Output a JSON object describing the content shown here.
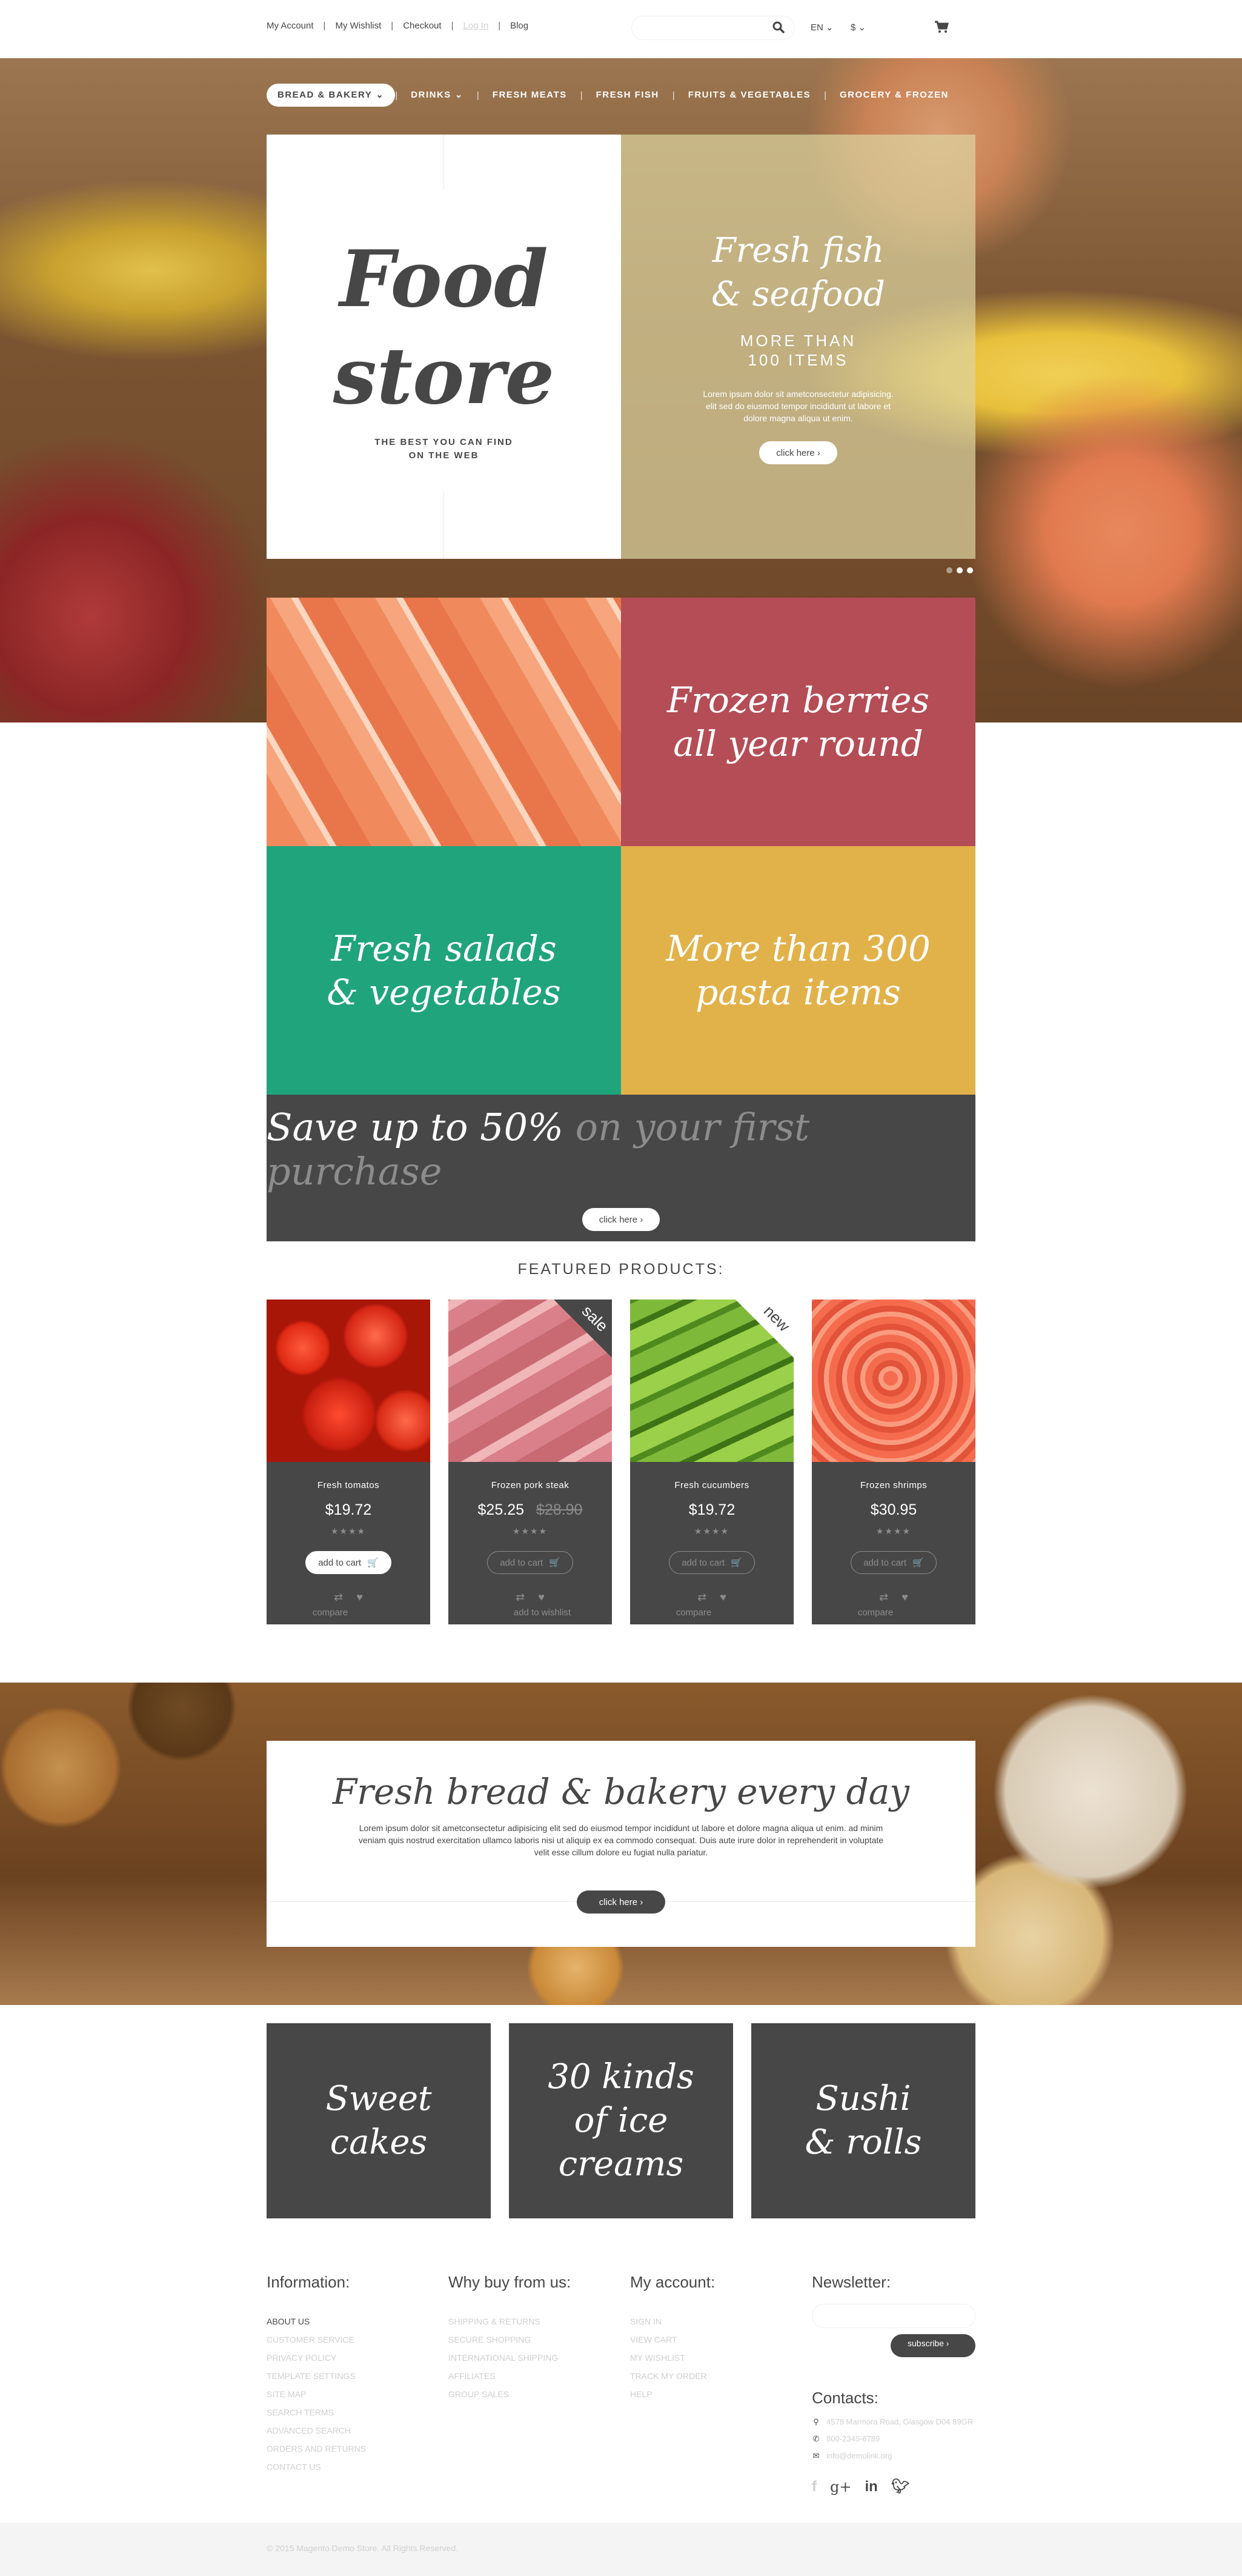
{
  "header": {
    "links": [
      {
        "label": "My Account",
        "muted": false
      },
      {
        "label": "My Wishlist",
        "muted": false
      },
      {
        "label": "Checkout",
        "muted": false
      },
      {
        "label": "Log In",
        "muted": true
      },
      {
        "label": "Blog",
        "muted": false
      }
    ],
    "search_placeholder": "",
    "language": "EN",
    "currency": "$"
  },
  "nav": {
    "items": [
      {
        "label": "BREAD & BAKERY",
        "has_dropdown": true,
        "active": true
      },
      {
        "label": "DRINKS",
        "has_dropdown": true,
        "active": false
      },
      {
        "label": "FRESH MEATS",
        "has_dropdown": false,
        "active": false
      },
      {
        "label": "FRESH FISH",
        "has_dropdown": false,
        "active": false
      },
      {
        "label": "FRUITS & VEGETABLES",
        "has_dropdown": false,
        "active": false
      },
      {
        "label": "GROCERY & FROZEN",
        "has_dropdown": false,
        "active": false
      }
    ]
  },
  "hero": {
    "logo_line1": "Food",
    "logo_line2": "store",
    "tagline_line1": "THE BEST YOU CAN FIND",
    "tagline_line2": "ON THE WEB",
    "slide_title_line1": "Fresh fish",
    "slide_title_line2": "& seafood",
    "slide_sub_line1": "MORE THAN",
    "slide_sub_line2": "100 ITEMS",
    "slide_text": "Lorem ipsum dolor sit ametconsectetur adipisicing. elit sed do eiusmod tempor incididunt ut labore et dolore magna aliqua ut enim.",
    "button": "click here ›",
    "slides_total": 3,
    "slide_active": 1
  },
  "promos": {
    "berries_line1": "Frozen berries",
    "berries_line2": "all year round",
    "salads_line1": "Fresh salads",
    "salads_line2": "& vegetables",
    "pasta_line1": "More than 300",
    "pasta_line2": "pasta items",
    "save_main": "Save up to 50%",
    "save_rest": "on your first purchase",
    "save_button": "click here ›",
    "colors": {
      "red": "#b54d56",
      "green": "#20a47c",
      "yellow": "#e2b24a",
      "dark": "#474747"
    }
  },
  "featured": {
    "title": "FEATURED PRODUCTS:",
    "products": [
      {
        "name": "Fresh tomatos",
        "price": "$19.72",
        "old_price": "",
        "badge": "",
        "rating": 4,
        "add_to_cart": "add to cart",
        "hover_label": "compare"
      },
      {
        "name": "Frozen pork steak",
        "price": "$25.25",
        "old_price": "$28.90",
        "badge": "sale",
        "rating": 4,
        "add_to_cart": "add to cart",
        "hover_label": "add to wishlist"
      },
      {
        "name": "Fresh cucumbers",
        "price": "$19.72",
        "old_price": "",
        "badge": "new",
        "rating": 4,
        "add_to_cart": "add to cart",
        "hover_label": "compare"
      },
      {
        "name": "Frozen shrimps",
        "price": "$30.95",
        "old_price": "",
        "badge": "",
        "rating": 4,
        "add_to_cart": "add to cart",
        "hover_label": "compare"
      }
    ]
  },
  "bakery": {
    "title": "Fresh bread & bakery every day",
    "text": "Lorem ipsum dolor sit ametconsectetur adipisicing elit sed do eiusmod tempor incididunt ut labore et dolore magna aliqua ut enim. ad minim veniam quis nostrud exercitation ullamco laboris nisi ut aliquip ex ea commodo consequat. Duis aute irure dolor in reprehenderit in voluptate velit esse cillum dolore eu fugiat nulla pariatur.",
    "button": "click here ›"
  },
  "categories": [
    {
      "line1": "Sweet",
      "line2": "cakes"
    },
    {
      "line1": "30 kinds",
      "line2": "of ice creams"
    },
    {
      "line1": "Sushi",
      "line2": "& rolls"
    }
  ],
  "footer": {
    "information": {
      "title": "Information:",
      "links": [
        "ABOUT US",
        "CUSTOMER SERVICE",
        "PRIVACY POLICY",
        "TEMPLATE SETTINGS",
        "SITE MAP",
        "SEARCH TERMS",
        "ADVANCED SEARCH",
        "ORDERS AND RETURNS",
        "CONTACT US"
      ]
    },
    "why_buy": {
      "title": "Why buy from us:",
      "links": [
        "SHIPPING & RETURNS",
        "SECURE SHOPPING",
        "INTERNATIONAL SHIPPING",
        "AFFILIATES",
        "GROUP SALES"
      ]
    },
    "my_account": {
      "title": "My account:",
      "links": [
        "SIGN IN",
        "VIEW CART",
        "MY WISHLIST",
        "TRACK MY ORDER",
        "HELP"
      ]
    },
    "newsletter": {
      "title": "Newsletter:",
      "placeholder": "",
      "button": "subscribe ›"
    },
    "contacts": {
      "title": "Contacts:",
      "address": "4578 Marmora Road, Glasgow D04 89GR",
      "phone": "800-2345-6789",
      "email": "info@demolink.org"
    },
    "social": [
      "facebook",
      "google-plus",
      "linkedin",
      "twitter"
    ],
    "copyright": "© 2015 Magento Demo Store. All Rights Reserved."
  }
}
